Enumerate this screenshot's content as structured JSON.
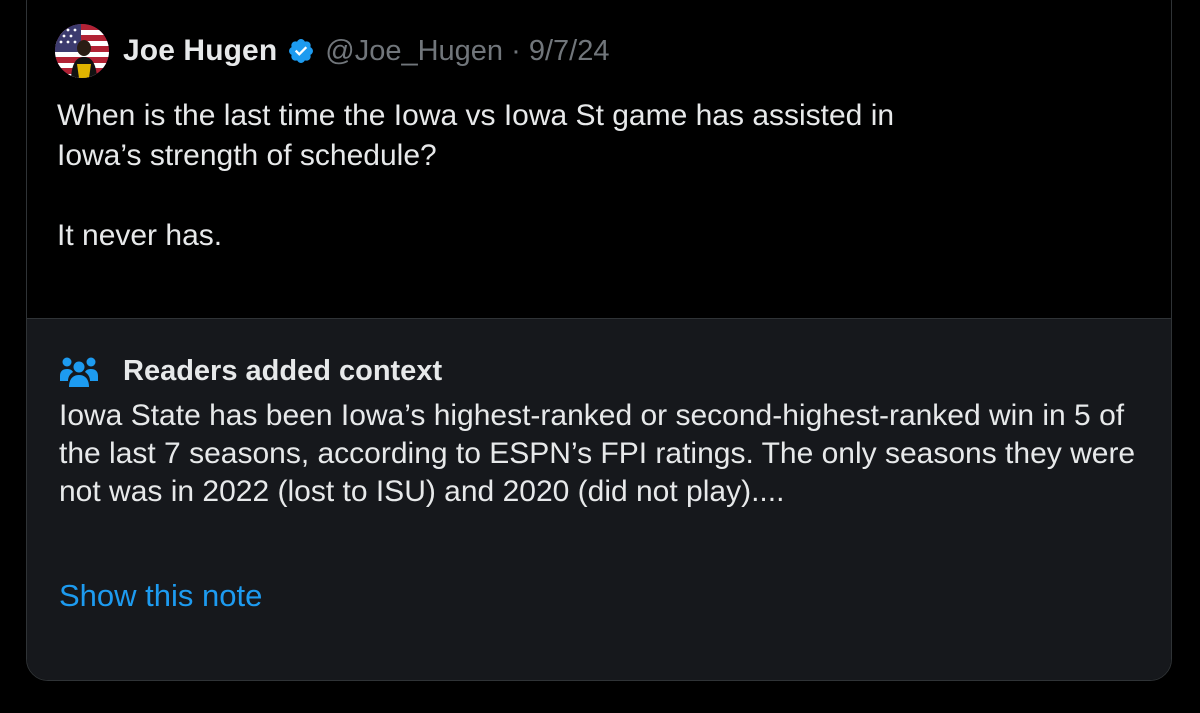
{
  "tweet": {
    "author_name": "Joe Hugen",
    "handle_date": "@Joe_Hugen · 9/7/24",
    "text": "When is the last time the Iowa vs Iowa St game has assisted in\nIowa’s strength of schedule?\n\nIt never has."
  },
  "community_note": {
    "title": "Readers added context",
    "text": "Iowa State has been Iowa’s highest-ranked or second-highest-ranked win in 5 of the last 7 seasons, according to ESPN’s FPI ratings. The only seasons they were not was in 2022 (lost to ISU) and 2020 (did not play)....",
    "link_label": "Show this note"
  },
  "colors": {
    "background": "#000000",
    "note_background": "#16181c",
    "primary_text": "#e7e9ea",
    "secondary_text": "#71767b",
    "accent": "#1d9bf0"
  },
  "icons": {
    "verified": "verified-badge-icon",
    "note": "people-group-icon"
  }
}
